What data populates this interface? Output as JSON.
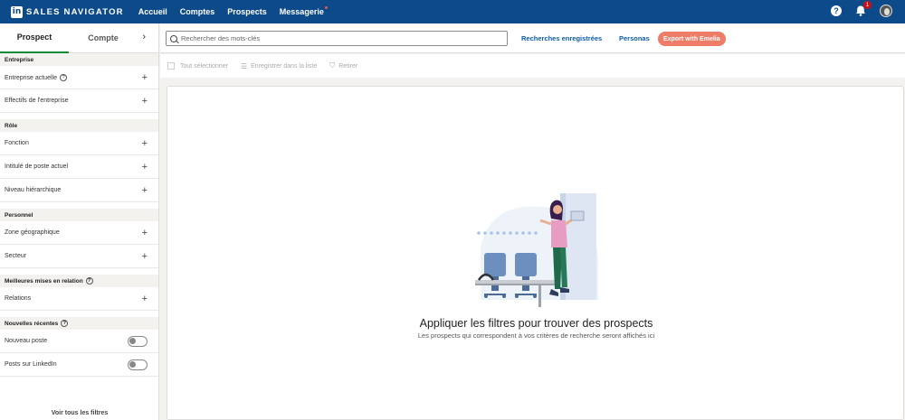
{
  "app": {
    "logo_letters": "in",
    "name": "SALES NAVIGATOR"
  },
  "nav": [
    "Accueil",
    "Comptes",
    "Prospects",
    "Messagerie"
  ],
  "notifications": {
    "count": "1"
  },
  "sidebar": {
    "tabs": [
      "Prospect",
      "Compte"
    ],
    "sections": [
      {
        "title": "Entreprise",
        "items": [
          "Entreprise actuelle",
          "Effectifs de l'entreprise"
        ]
      },
      {
        "title": "Rôle",
        "items": [
          "Fonction",
          "Intitulé de poste actuel",
          "Niveau hiérarchique"
        ]
      },
      {
        "title": "Personnel",
        "items": [
          "Zone géographique",
          "Secteur"
        ]
      },
      {
        "title": "Meilleures mises en relation",
        "items": [
          "Relations"
        ]
      },
      {
        "title": "Nouvelles récentes",
        "items": [
          "Nouveau poste",
          "Posts sur LinkedIn"
        ]
      }
    ],
    "see_all": "Voir tous les filtres"
  },
  "search": {
    "placeholder": "Rechercher des mots-clés",
    "saved_searches": "Recherches enregistrées",
    "personas": "Personas",
    "export": "Export with Emelia"
  },
  "actions": {
    "select_all": "Tout sélectionner",
    "save_list": "Enregistrer dans la liste",
    "save": "Retirer"
  },
  "empty_state": {
    "title": "Appliquer les filtres pour trouver des prospects",
    "subtitle": "Les prospects qui correspondent à vos critères de recherche seront affichés ici"
  },
  "colors": {
    "brand": "#0c4a8a",
    "active_tab": "#138a36",
    "export_button": "#ee7c67"
  }
}
